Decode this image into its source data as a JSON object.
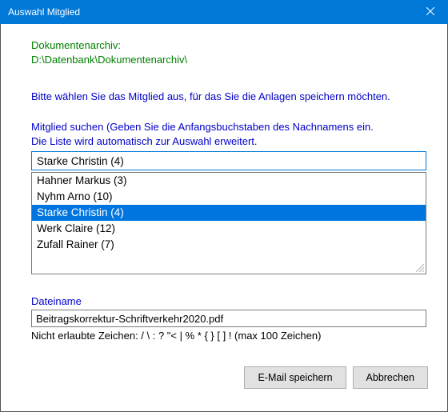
{
  "titlebar": {
    "title": "Auswahl Mitglied"
  },
  "archive": {
    "label": "Dokumentenarchiv:",
    "path": "D:\\Datenbank\\Dokumentenarchiv\\"
  },
  "prompt": {
    "line1": "Bitte wählen Sie das Mitglied aus, für das Sie die Anlagen speichern möchten.",
    "line2a": "Mitglied suchen (Geben Sie die Anfangsbuchstaben des Nachnamens ein.",
    "line2b": "Die Liste wird automatisch zur Auswahl erweitert."
  },
  "search": {
    "value": "Starke Christin (4)"
  },
  "members": [
    {
      "label": "Hahner Markus (3)",
      "selected": false
    },
    {
      "label": "Nyhm Arno (10)",
      "selected": false
    },
    {
      "label": "Starke Christin (4)",
      "selected": true
    },
    {
      "label": "Werk Claire (12)",
      "selected": false
    },
    {
      "label": "Zufall Rainer (7)",
      "selected": false
    }
  ],
  "filename": {
    "label": "Dateiname",
    "value": "Beitragskorrektur-Schriftverkehr2020.pdf",
    "hint": "Nicht erlaubte Zeichen: / \\ : ? \"< |  % * { } [ ] !    (max 100 Zeichen)"
  },
  "buttons": {
    "save": "E-Mail speichern",
    "cancel": "Abbrechen"
  }
}
